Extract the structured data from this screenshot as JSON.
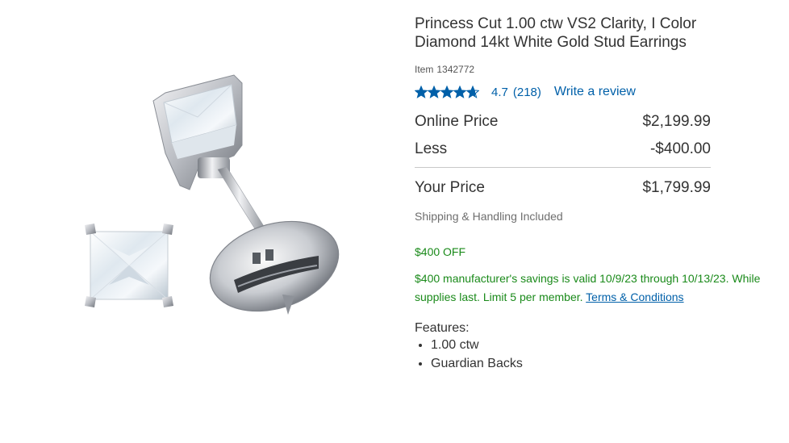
{
  "product": {
    "title": "Princess Cut 1.00 ctw VS2 Clarity, I Color Diamond 14kt White Gold Stud Earrings",
    "item_label": "Item",
    "item_number": "1342772",
    "image_icon": "diamond-stud-earrings-image"
  },
  "rating": {
    "stars": 4.7,
    "value": "4.7",
    "count": "(218)",
    "write_review": "Write a review",
    "star_color": "#0060a9"
  },
  "pricing": {
    "online_label": "Online Price",
    "online_value": "$2,199.99",
    "less_label": "Less",
    "less_value": "-$400.00",
    "your_label": "Your Price",
    "your_value": "$1,799.99",
    "shipping": "Shipping & Handling Included"
  },
  "offer": {
    "title": "$400 OFF",
    "text": "$400 manufacturer's savings is valid 10/9/23 through 10/13/23. While supplies last. Limit 5 per member.",
    "terms_link": "Terms & Conditions",
    "color": "#1a8a1a"
  },
  "features": {
    "label": "Features:",
    "items": [
      "1.00 ctw",
      "Guardian Backs"
    ]
  }
}
